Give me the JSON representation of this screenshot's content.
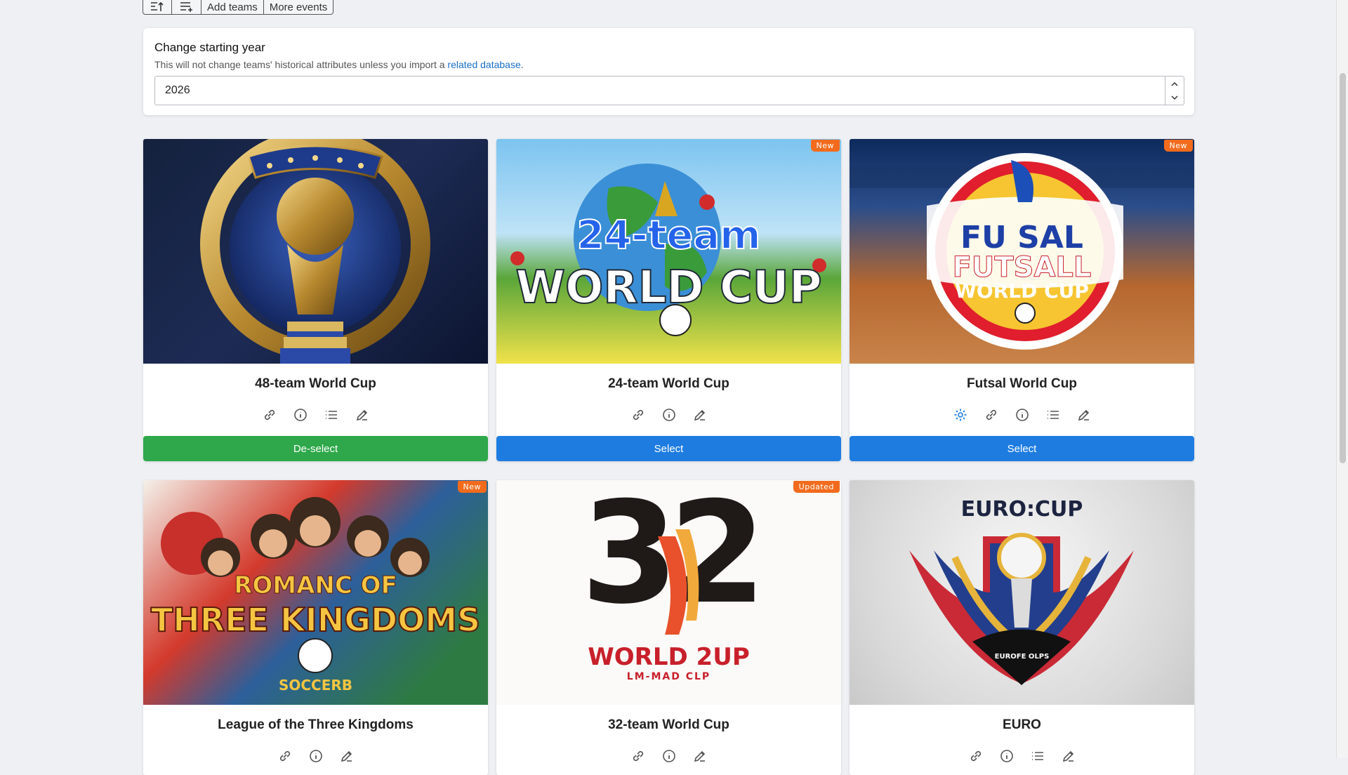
{
  "toolbar": {
    "sort_icon": "sort-icon",
    "add_list_icon": "playlist-add-icon",
    "add_teams": "Add teams",
    "more_events": "More events"
  },
  "year": {
    "title": "Change starting year",
    "subtitle": "This will not change teams' historical attributes unless you import a",
    "link": "related database",
    "subtitle_end": ".",
    "value": "2026"
  },
  "cards": [
    {
      "title": "48-team World Cup",
      "badge": "",
      "icons": [
        "link-icon",
        "info-icon",
        "list-icon",
        "edit-icon"
      ],
      "button": "De-select",
      "selected": true,
      "art": {
        "line1": "",
        "line2": "",
        "line3": ""
      }
    },
    {
      "title": "24-team World Cup",
      "badge": "New",
      "icons": [
        "link-icon",
        "info-icon",
        "edit-icon"
      ],
      "button": "Select",
      "selected": false,
      "art": {
        "line1": "24-team",
        "line2": "WORLD CUP",
        "line3": ""
      }
    },
    {
      "title": "Futsal World Cup",
      "badge": "New",
      "icons": [
        "gear-icon",
        "link-icon",
        "info-icon",
        "list-icon",
        "edit-icon"
      ],
      "button": "Select",
      "selected": false,
      "art": {
        "line1": "FU SAL",
        "line2": "FUTSALL",
        "line3": "WORLD CUP"
      }
    },
    {
      "title": "League of the Three Kingdoms",
      "badge": "New",
      "icons": [
        "link-icon",
        "info-icon",
        "edit-icon"
      ],
      "button": "",
      "selected": false,
      "art": {
        "line1": "ROMANC OF",
        "line2": "THREE KINGDOMS",
        "line3": "SOCCERB"
      }
    },
    {
      "title": "32-team World Cup",
      "badge": "Updated",
      "icons": [
        "link-icon",
        "info-icon",
        "edit-icon"
      ],
      "button": "",
      "selected": false,
      "art": {
        "line1": "32",
        "line2": "WORLD 2UP",
        "line3": "LM-MAD CLP"
      }
    },
    {
      "title": "EURO",
      "badge": "",
      "icons": [
        "link-icon",
        "info-icon",
        "list-icon",
        "edit-icon"
      ],
      "button": "",
      "selected": false,
      "art": {
        "line1": "EURO:CUP",
        "line2": "EUROFE OLPS",
        "line3": ""
      }
    }
  ],
  "colors": {
    "select_blue": "#1e7ce0",
    "deselect_green": "#2ea84a",
    "badge_orange": "#f26b1d",
    "link_blue": "#1a6fc9"
  }
}
